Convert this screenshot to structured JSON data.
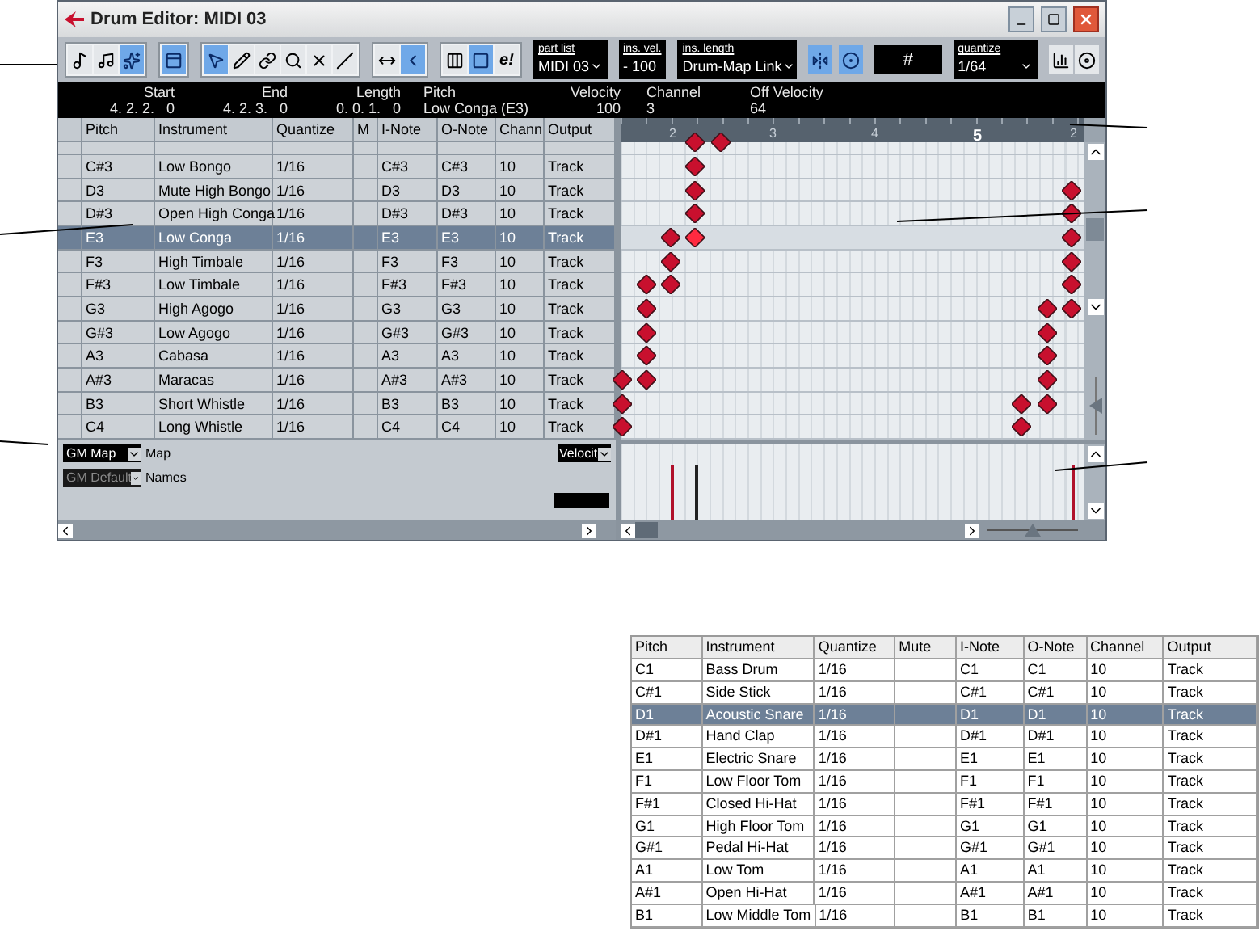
{
  "window": {
    "title": "Drum Editor: MIDI 03"
  },
  "toolbar": {
    "groups": [
      [
        {
          "kind": "solo",
          "selected": false
        },
        {
          "kind": "edit-solo",
          "selected": false
        },
        {
          "kind": "feedback",
          "selected": true
        }
      ],
      [
        {
          "kind": "info",
          "selected": true
        }
      ],
      [
        {
          "kind": "arrow",
          "selected": true
        },
        {
          "kind": "pencil",
          "selected": false
        },
        {
          "kind": "glue",
          "selected": false
        },
        {
          "kind": "zoom",
          "selected": false
        },
        {
          "kind": "mute",
          "selected": false
        },
        {
          "kind": "line",
          "selected": false
        }
      ],
      [
        {
          "kind": "autoscroll",
          "selected": false
        },
        {
          "kind": "caret",
          "selected": true
        }
      ],
      [
        {
          "kind": "drum-map",
          "selected": false
        },
        {
          "kind": "insert",
          "selected": true
        },
        {
          "kind": "text",
          "label": "e!",
          "selected": false
        }
      ]
    ],
    "part_list": {
      "label": "part list",
      "value": "MIDI 03"
    },
    "ins_vel": {
      "label": "ins. vel.",
      "value": "- 100"
    },
    "ins_length": {
      "label": "ins. length",
      "value": "Drum-Map Link"
    },
    "mid_buttons": [
      {
        "kind": "snap",
        "selected": true
      },
      {
        "kind": "quantize",
        "selected": true
      }
    ],
    "grid_field": {
      "value": "#"
    },
    "quantize": {
      "label": "quantize",
      "value": "1/64"
    },
    "end_buttons": [
      {
        "kind": "bars",
        "selected": false
      },
      {
        "kind": "dial",
        "selected": false
      }
    ]
  },
  "info_line": [
    {
      "label": "Start",
      "value": "4. 2. 2.   0"
    },
    {
      "label": "End",
      "value": "4. 2. 3.   0"
    },
    {
      "label": "Length",
      "value": "0. 0. 1.   0"
    },
    {
      "label": "Pitch",
      "value": "Low Conga (E3)"
    },
    {
      "label": "Velocity",
      "value": "100"
    },
    {
      "label": "Channel",
      "value": "3"
    },
    {
      "label": "Off Velocity",
      "value": "64"
    }
  ],
  "drum_list": {
    "columns": [
      "Pitch",
      "Instrument",
      "Quantize",
      "M",
      "I-Note",
      "O-Note",
      "Chann",
      "Output"
    ],
    "rows": [
      {
        "pitch": "C#3",
        "instrument": "Low Bongo",
        "quantize": "1/16",
        "i_note": "C#3",
        "o_note": "C#3",
        "channel": "10",
        "output": "Track",
        "selected": false
      },
      {
        "pitch": "D3",
        "instrument": "Mute High Bongo",
        "quantize": "1/16",
        "i_note": "D3",
        "o_note": "D3",
        "channel": "10",
        "output": "Track",
        "selected": false
      },
      {
        "pitch": "D#3",
        "instrument": "Open High Conga",
        "quantize": "1/16",
        "i_note": "D#3",
        "o_note": "D#3",
        "channel": "10",
        "output": "Track",
        "selected": false
      },
      {
        "pitch": "E3",
        "instrument": "Low Conga",
        "quantize": "1/16",
        "i_note": "E3",
        "o_note": "E3",
        "channel": "10",
        "output": "Track",
        "selected": true
      },
      {
        "pitch": "F3",
        "instrument": "High Timbale",
        "quantize": "1/16",
        "i_note": "F3",
        "o_note": "F3",
        "channel": "10",
        "output": "Track",
        "selected": false
      },
      {
        "pitch": "F#3",
        "instrument": "Low Timbale",
        "quantize": "1/16",
        "i_note": "F#3",
        "o_note": "F#3",
        "channel": "10",
        "output": "Track",
        "selected": false
      },
      {
        "pitch": "G3",
        "instrument": "High Agogo",
        "quantize": "1/16",
        "i_note": "G3",
        "o_note": "G3",
        "channel": "10",
        "output": "Track",
        "selected": false
      },
      {
        "pitch": "G#3",
        "instrument": "Low Agogo",
        "quantize": "1/16",
        "i_note": "G#3",
        "o_note": "G#3",
        "channel": "10",
        "output": "Track",
        "selected": false
      },
      {
        "pitch": "A3",
        "instrument": "Cabasa",
        "quantize": "1/16",
        "i_note": "A3",
        "o_note": "A3",
        "channel": "10",
        "output": "Track",
        "selected": false
      },
      {
        "pitch": "A#3",
        "instrument": "Maracas",
        "quantize": "1/16",
        "i_note": "A#3",
        "o_note": "A#3",
        "channel": "10",
        "output": "Track",
        "selected": false
      },
      {
        "pitch": "B3",
        "instrument": "Short Whistle",
        "quantize": "1/16",
        "i_note": "B3",
        "o_note": "B3",
        "channel": "10",
        "output": "Track",
        "selected": false
      },
      {
        "pitch": "C4",
        "instrument": "Long Whistle",
        "quantize": "1/16",
        "i_note": "C4",
        "o_note": "C4",
        "channel": "10",
        "output": "Track",
        "selected": false
      }
    ]
  },
  "map_controls": {
    "map": {
      "value": "GM Map",
      "label": "Map"
    },
    "names": {
      "value": "GM Default",
      "label": "Names"
    },
    "lane": {
      "value": "Velocit"
    }
  },
  "ruler": [
    {
      "label": "2",
      "bold": false
    },
    {
      "label": "3",
      "bold": false
    },
    {
      "label": "4",
      "bold": false
    },
    {
      "label": "5",
      "bold": true
    },
    {
      "label": "2",
      "bold": false
    }
  ],
  "table": {
    "columns": [
      "Pitch",
      "Instrument",
      "Quantize",
      "Mute",
      "I-Note",
      "O-Note",
      "Channel",
      "Output"
    ],
    "rows": [
      {
        "pitch": "C1",
        "instrument": "Bass Drum",
        "quantize": "1/16",
        "i_note": "C1",
        "o_note": "C1",
        "channel": "10",
        "output": "Track",
        "selected": false
      },
      {
        "pitch": "C#1",
        "instrument": "Side Stick",
        "quantize": "1/16",
        "i_note": "C#1",
        "o_note": "C#1",
        "channel": "10",
        "output": "Track",
        "selected": false
      },
      {
        "pitch": "D1",
        "instrument": "Acoustic Snare",
        "quantize": "1/16",
        "i_note": "D1",
        "o_note": "D1",
        "channel": "10",
        "output": "Track",
        "selected": true
      },
      {
        "pitch": "D#1",
        "instrument": "Hand Clap",
        "quantize": "1/16",
        "i_note": "D#1",
        "o_note": "D#1",
        "channel": "10",
        "output": "Track",
        "selected": false
      },
      {
        "pitch": "E1",
        "instrument": "Electric Snare",
        "quantize": "1/16",
        "i_note": "E1",
        "o_note": "E1",
        "channel": "10",
        "output": "Track",
        "selected": false
      },
      {
        "pitch": "F1",
        "instrument": "Low Floor Tom",
        "quantize": "1/16",
        "i_note": "F1",
        "o_note": "F1",
        "channel": "10",
        "output": "Track",
        "selected": false
      },
      {
        "pitch": "F#1",
        "instrument": "Closed Hi-Hat",
        "quantize": "1/16",
        "i_note": "F#1",
        "o_note": "F#1",
        "channel": "10",
        "output": "Track",
        "selected": false
      },
      {
        "pitch": "G1",
        "instrument": "High Floor Tom",
        "quantize": "1/16",
        "i_note": "G1",
        "o_note": "G1",
        "channel": "10",
        "output": "Track",
        "selected": false
      },
      {
        "pitch": "G#1",
        "instrument": "Pedal Hi-Hat",
        "quantize": "1/16",
        "i_note": "G#1",
        "o_note": "G#1",
        "channel": "10",
        "output": "Track",
        "selected": false
      },
      {
        "pitch": "A1",
        "instrument": "Low Tom",
        "quantize": "1/16",
        "i_note": "A1",
        "o_note": "A1",
        "channel": "10",
        "output": "Track",
        "selected": false
      },
      {
        "pitch": "A#1",
        "instrument": "Open Hi-Hat",
        "quantize": "1/16",
        "i_note": "A#1",
        "o_note": "A#1",
        "channel": "10",
        "output": "Track",
        "selected": false
      },
      {
        "pitch": "B1",
        "instrument": "Low Middle Tom",
        "quantize": "1/16",
        "i_note": "B1",
        "o_note": "B1",
        "channel": "10",
        "output": "Track",
        "selected": false
      }
    ]
  }
}
